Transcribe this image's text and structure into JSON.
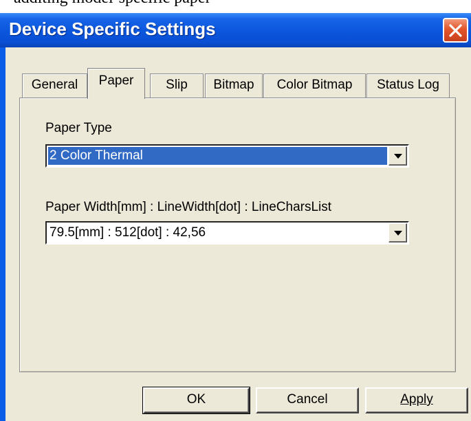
{
  "background_text": "additing model-specific paper",
  "window": {
    "title": "Device Specific Settings",
    "close_label": "close"
  },
  "tabs": [
    {
      "label": "General"
    },
    {
      "label": "Paper",
      "active": true
    },
    {
      "label": "Slip"
    },
    {
      "label": "Bitmap"
    },
    {
      "label": "Color Bitmap"
    },
    {
      "label": "Status Log"
    }
  ],
  "paper_tab": {
    "paper_type_label": "Paper Type",
    "paper_type_value": "2 Color Thermal",
    "paper_width_label": "Paper Width[mm] : LineWidth[dot] : LineCharsList",
    "paper_width_value": "79.5[mm] : 512[dot] : 42,56"
  },
  "buttons": {
    "ok": "OK",
    "cancel": "Cancel",
    "apply": "Apply"
  },
  "colors": {
    "titlebar": "#0a55dc",
    "face": "#ece9d8",
    "selection": "#316ac5",
    "close": "#e3562b"
  }
}
